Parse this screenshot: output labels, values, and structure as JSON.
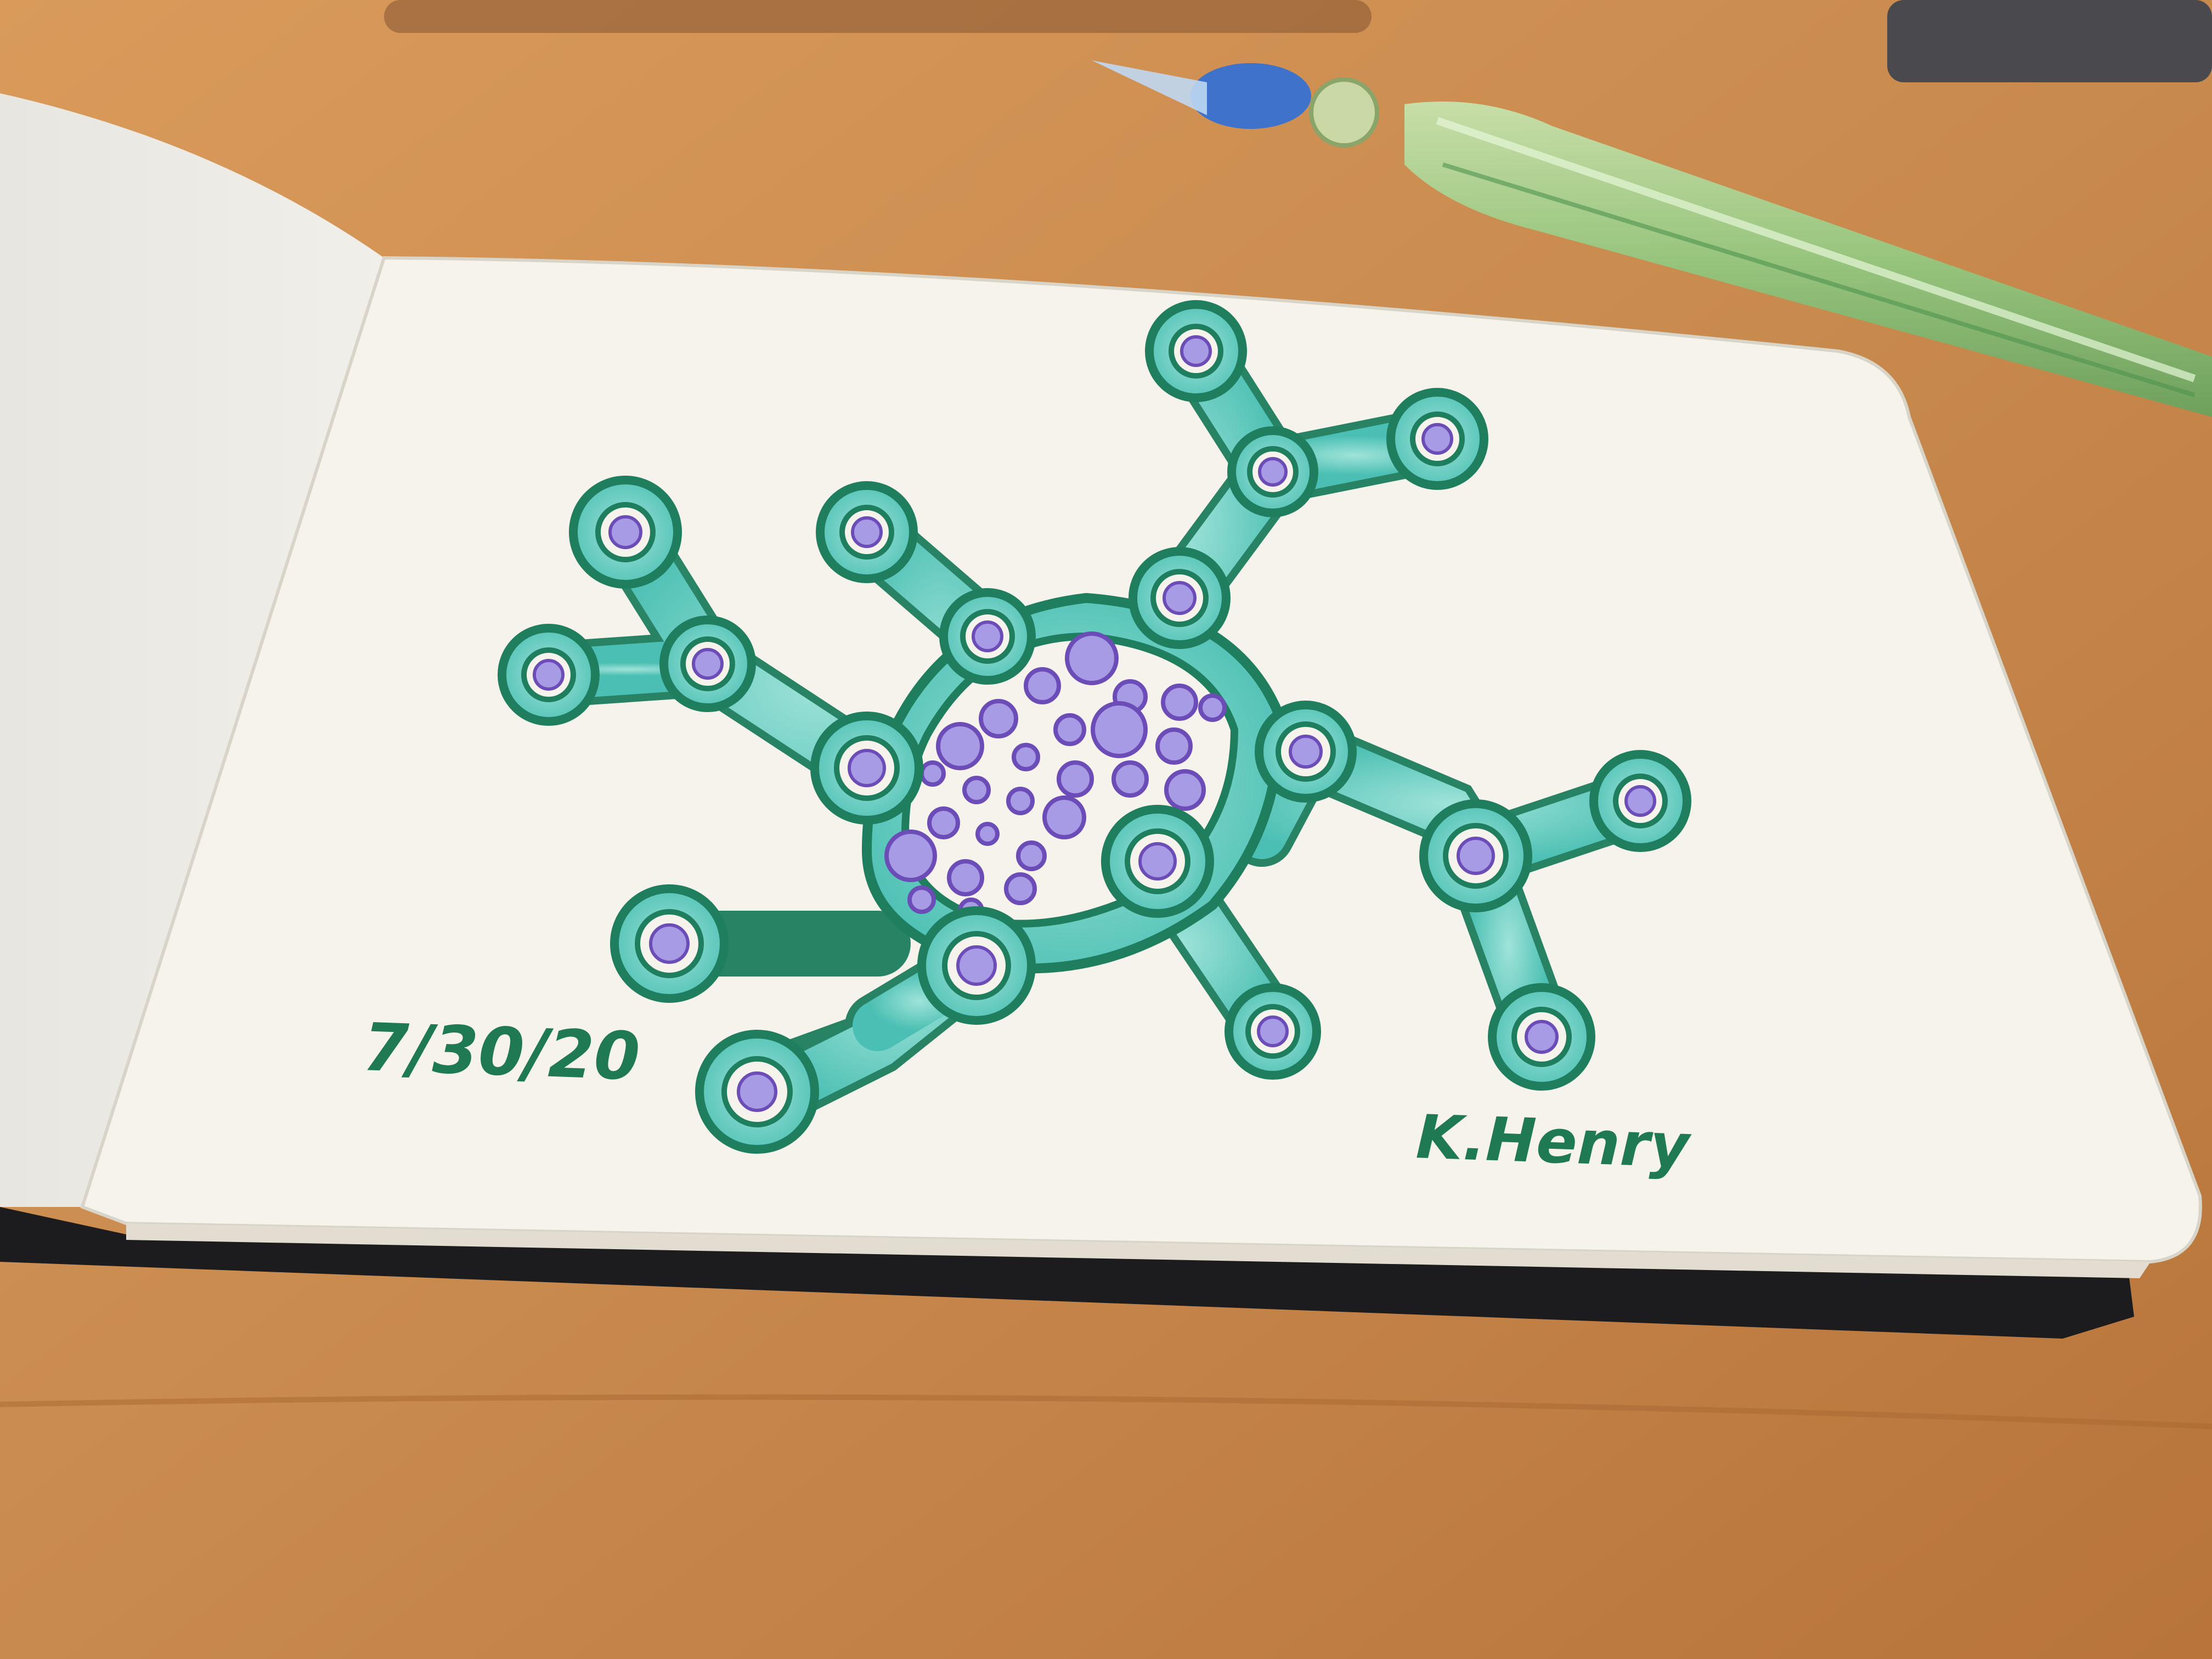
{
  "sketch": {
    "date": "7/30/20",
    "signature": "K.Henry"
  },
  "colors": {
    "table": "#c98a4e",
    "paper": "#f5f3ec",
    "ink_outline": "#1e7e5e",
    "teal_fill": "#6fd0c6",
    "violet": "#a89be6",
    "violet_outline": "#6c4db8",
    "pen_glass": "#9fd49a",
    "pen_blue": "#2f6fd8"
  },
  "icons": [
    "glass-dip-pen",
    "sketchbook"
  ]
}
